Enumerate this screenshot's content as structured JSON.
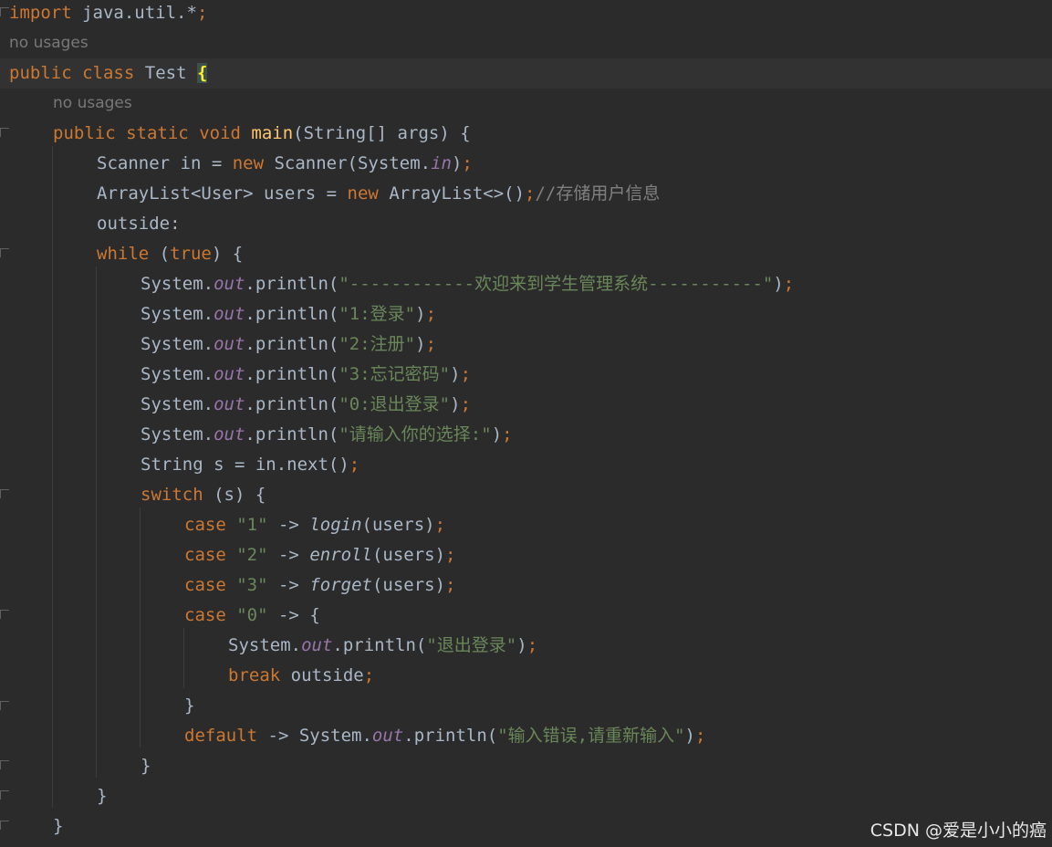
{
  "code": {
    "import_kw": "import",
    "import_pkg": "java.util.*",
    "semicolon": ";",
    "usage_hint": "no usages",
    "public_kw": "public",
    "class_kw": "class",
    "class_name": "Test",
    "open_brace": "{",
    "close_brace": "}",
    "static_kw": "static",
    "void_kw": "void",
    "main_name": "main",
    "main_params": "(String[] args) {",
    "scanner_type": "Scanner in = ",
    "new_kw": "new",
    "scanner_ctor": " Scanner(System.",
    "in_field": "in",
    "scanner_end": ")",
    "arraylist_type": "ArrayList<User> users = ",
    "arraylist_ctor": " ArrayList<>()",
    "arraylist_comment": "//存储用户信息",
    "label_outside": "outside:",
    "while_kw": "while",
    "while_open": " (",
    "true_kw": "true",
    "while_close": ") {",
    "system_prefix": "System.",
    "out_field": "out",
    "println_open": ".println(",
    "println_close": ")",
    "str_welcome": "\"------------欢迎来到学生管理系统-----------\"",
    "str_login": "\"1:登录\"",
    "str_register": "\"2:注册\"",
    "str_forgot": "\"3:忘记密码\"",
    "str_logout_menu": "\"0:退出登录\"",
    "str_choose": "\"请输入你的选择:\"",
    "string_decl": "String s = in.next()",
    "switch_kw": "switch",
    "switch_rest": " (s) {",
    "case_kw": "case",
    "case1_val": "\"1\"",
    "case2_val": "\"2\"",
    "case3_val": "\"3\"",
    "case0_val": "\"0\"",
    "arrow": " -> ",
    "login_fn": "login",
    "enroll_fn": "enroll",
    "forget_fn": "forget",
    "users_arg": "(users)",
    "str_logout": "\"退出登录\"",
    "break_kw": "break",
    "break_label": " outside",
    "default_kw": "default",
    "str_error": "\"输入错误,请重新输入\""
  },
  "watermark": "CSDN @爱是小小的癌",
  "colors": {
    "background": "#2b2b2b",
    "keyword": "#cc7832",
    "string": "#6a8759",
    "field": "#9876aa",
    "method_decl": "#ffc66d",
    "plain": "#a9b7c6",
    "comment": "#808080",
    "hint": "#787878"
  }
}
